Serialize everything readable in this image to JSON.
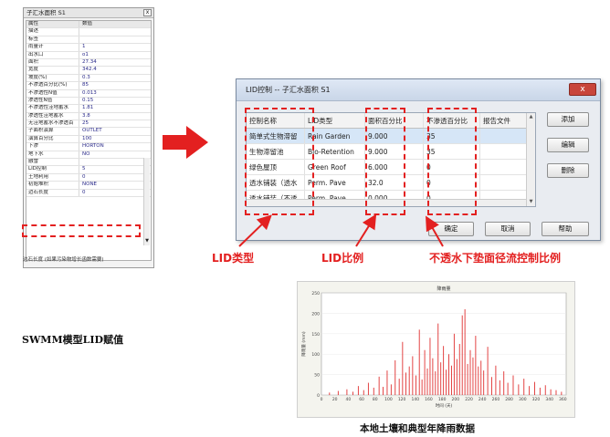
{
  "property_panel": {
    "title": "子汇水面积 S1",
    "close_label": "x",
    "header": {
      "name": "属性",
      "value": "数值"
    },
    "rows": [
      {
        "name": "描述",
        "value": ""
      },
      {
        "name": "标签",
        "value": ""
      },
      {
        "name": "雨量计",
        "value": "1"
      },
      {
        "name": "出水口",
        "value": "o1"
      },
      {
        "name": "面积",
        "value": "27.34"
      },
      {
        "name": "宽度",
        "value": "342.4"
      },
      {
        "name": "坡度(%)",
        "value": "0.3"
      },
      {
        "name": "不渗透百分比(%)",
        "value": "85"
      },
      {
        "name": "不渗透性N值",
        "value": "0.013"
      },
      {
        "name": "渗透性N值",
        "value": "0.15"
      },
      {
        "name": "不渗透性洼地蓄水",
        "value": "1.81"
      },
      {
        "name": "渗透性洼地蓄水",
        "value": "3.8"
      },
      {
        "name": "无洼地蓄水不渗透百",
        "value": "25"
      },
      {
        "name": "子面积演算",
        "value": "OUTLET"
      },
      {
        "name": "演算百分比",
        "value": "100"
      },
      {
        "name": "下渗",
        "value": "HORTON"
      },
      {
        "name": "地下水",
        "value": "NO"
      },
      {
        "name": "融雪",
        "value": ""
      },
      {
        "name": "LID控制",
        "value": "5"
      },
      {
        "name": "土地利用",
        "value": "0"
      },
      {
        "name": "初始堆积",
        "value": "NONE"
      },
      {
        "name": "边石长度",
        "value": "0"
      }
    ],
    "description": "边石长度 (如果污染物增长函数需要)",
    "caption": "SWMM模型LID赋值"
  },
  "lid_dialog": {
    "title": "LID控制 -- 子汇水面积 S1",
    "close_label": "x",
    "columns": [
      "控制名称",
      "LID类型",
      "面积百分比",
      "不渗透百分比",
      "报告文件"
    ],
    "rows": [
      [
        "简单式生物滞留",
        "Rain Garden",
        "9.000",
        "35",
        ""
      ],
      [
        "生物滞留池",
        "Bio-Retention",
        "9.000",
        "35",
        ""
      ],
      [
        "绿色屋顶",
        "Green Roof",
        "6.000",
        "0",
        ""
      ],
      [
        "透水铺装（透水",
        "Perm. Pave",
        "32.0",
        "0",
        ""
      ],
      [
        "透水铺装（不透",
        "Perm. Pave",
        "0.000",
        "0",
        ""
      ]
    ],
    "buttons": {
      "add": "添加",
      "edit": "编辑",
      "delete": "删除",
      "ok": "确定",
      "cancel": "取消",
      "help": "帮助"
    }
  },
  "annotations": {
    "lid_type": "LID类型",
    "lid_ratio": "LID比例",
    "impervious_ratio": "不透水下垫面径流控制比例",
    "accent_color": "#e32020"
  },
  "chart_data": {
    "type": "bar",
    "title": "降雨量",
    "xlabel": "时间 (天)",
    "ylabel": "降雨量 (mm)",
    "xlim": [
      0,
      365
    ],
    "ylim": [
      0,
      250
    ],
    "xticks": [
      0,
      20,
      40,
      60,
      80,
      100,
      120,
      140,
      160,
      180,
      200,
      220,
      240,
      260,
      280,
      300,
      320,
      340,
      360
    ],
    "yticks": [
      0,
      50,
      100,
      150,
      200,
      250
    ],
    "series_color": "#e03030",
    "x": [
      12,
      25,
      38,
      47,
      55,
      63,
      70,
      78,
      86,
      92,
      98,
      104,
      110,
      116,
      121,
      126,
      131,
      136,
      141,
      146,
      150,
      154,
      158,
      162,
      166,
      170,
      174,
      178,
      182,
      186,
      190,
      194,
      198,
      202,
      206,
      210,
      214,
      218,
      222,
      226,
      230,
      234,
      238,
      242,
      248,
      254,
      260,
      266,
      272,
      278,
      286,
      294,
      302,
      310,
      318,
      326,
      334,
      342,
      350,
      358
    ],
    "values": [
      6,
      10,
      14,
      8,
      22,
      12,
      30,
      18,
      45,
      20,
      60,
      26,
      85,
      40,
      130,
      55,
      70,
      95,
      48,
      160,
      38,
      110,
      65,
      140,
      90,
      58,
      175,
      80,
      120,
      62,
      100,
      72,
      150,
      88,
      125,
      195,
      210,
      76,
      110,
      92,
      145,
      70,
      84,
      60,
      118,
      44,
      72,
      36,
      58,
      30,
      48,
      26,
      40,
      22,
      32,
      18,
      24,
      14,
      12,
      8
    ],
    "caption": "本地土壤和典型年降雨数据"
  }
}
